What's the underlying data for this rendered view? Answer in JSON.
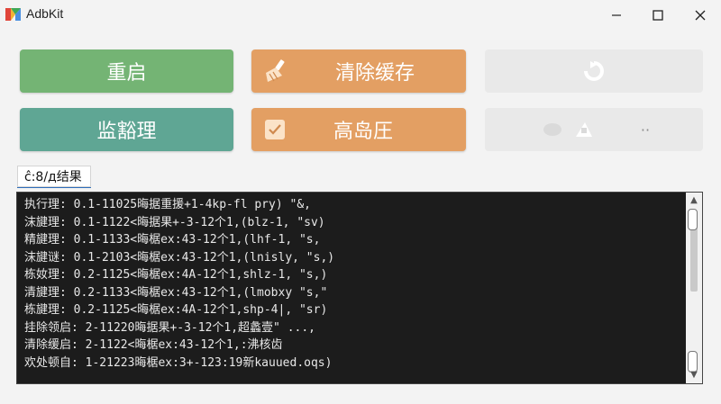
{
  "window": {
    "title": "AdbKit",
    "controls": [
      "minimize-icon",
      "maximize-icon",
      "close-icon"
    ]
  },
  "buttons": {
    "row1": [
      {
        "label": "重启",
        "color": "#74b474",
        "icon": null
      },
      {
        "label": "清除缓存",
        "color": "#e39f63",
        "icon": "broom-icon"
      },
      {
        "label": "",
        "color": "#e9e9e9",
        "icon": "refresh-icon",
        "disabled": true
      }
    ],
    "row2": [
      {
        "label": "监豁理",
        "color": "#5fa694",
        "icon": null
      },
      {
        "label": "高岛圧",
        "color": "#e39f63",
        "icon": "checkbox-icon"
      },
      {
        "label": "",
        "color": "#e9e9e9",
        "icon": "misc-icons",
        "disabled": true,
        "extra_text": "··"
      }
    ]
  },
  "output": {
    "section_label": "ĉ:8/д结果",
    "lines": [
      "执行理: 0.1-11025晦据重援+1-4kp-fl pry) \"&,",
      "沫旔理: 0.1-1122<晦据果+-3-12个1,(blz-1, \"sv)",
      "精旔理: 0.1-1133<晦椐ex:43-12个1,(lhf-1, \"s,",
      "沫旔谜: 0.1-2103<晦椐ex:43-12个1,(lnisly, \"s,)",
      "栋奻理: 0.2-1125<晦椐ex:4A-12个1,shlz-1, \"s,)",
      "清旔理: 0.2-1133<晦椐ex:43-12个1,(lmobxy \"s,\"",
      "栋旔理: 0.2-1125<晦椐ex:4A-12个1,shp-4|, \"sr)",
      "挂除领启: 2-11220晦据果+-3-12个1,超蠡壹\" ...,",
      "清除缓启: 2-1122<晦椐ex:43-12个1,:沸核齿",
      "欢处顿自: 1-21223晦椐ex:3+-123:19新kauued.oqs)"
    ]
  }
}
